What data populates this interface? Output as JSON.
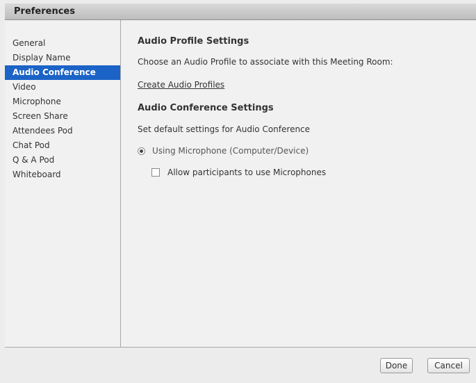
{
  "window": {
    "title": "Preferences"
  },
  "sidebar": {
    "items": [
      {
        "label": "General"
      },
      {
        "label": "Display Name"
      },
      {
        "label": "Audio Conference"
      },
      {
        "label": "Video"
      },
      {
        "label": "Microphone"
      },
      {
        "label": "Screen Share"
      },
      {
        "label": "Attendees Pod"
      },
      {
        "label": "Chat Pod"
      },
      {
        "label": "Q & A Pod"
      },
      {
        "label": "Whiteboard"
      }
    ],
    "selected": "Audio Conference"
  },
  "main": {
    "profile_heading": "Audio Profile Settings",
    "profile_text": "Choose an Audio Profile to associate with this Meeting Room:",
    "create_link": "Create Audio Profiles",
    "conference_heading": "Audio Conference Settings",
    "conference_text": "Set default settings for Audio Conference",
    "radio_label": "Using Microphone (Computer/Device)",
    "radio_selected": true,
    "checkbox_label": "Allow participants to use Microphones",
    "checkbox_checked": false
  },
  "footer": {
    "done_label": "Done",
    "cancel_label": "Cancel"
  },
  "colors": {
    "selection": "#1b63c6",
    "background": "#f1f1f1"
  }
}
